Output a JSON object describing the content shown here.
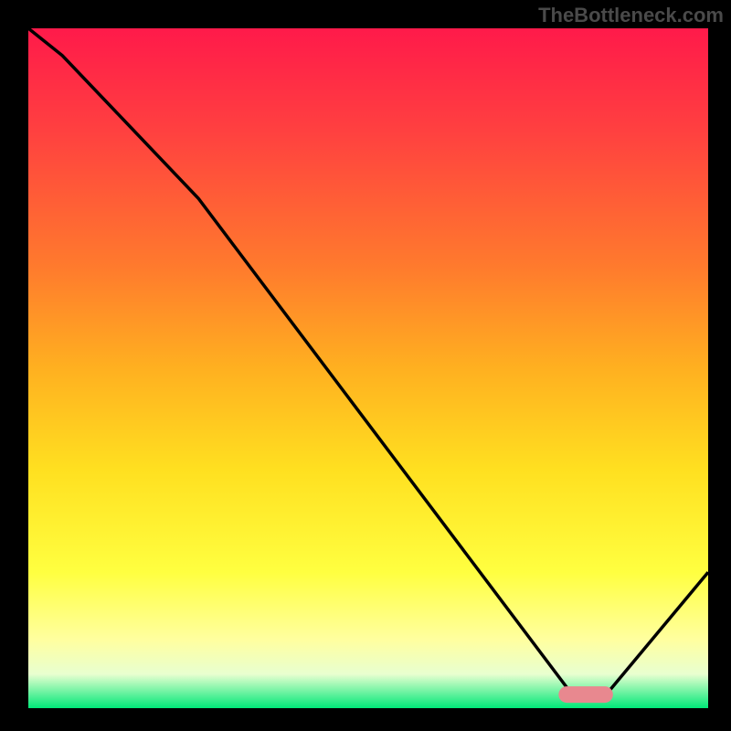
{
  "watermark": "TheBottleneck.com",
  "chart_data": {
    "type": "line",
    "title": "",
    "xlabel": "",
    "ylabel": "",
    "xlim": [
      0,
      100
    ],
    "ylim": [
      0,
      100
    ],
    "series": [
      {
        "name": "curve",
        "x": [
          0,
          5,
          25,
          80,
          85,
          100
        ],
        "y": [
          100,
          96,
          75,
          2,
          2,
          20
        ]
      }
    ],
    "marker": {
      "x_start": 78,
      "x_end": 86,
      "y": 2,
      "color": "#e8888f"
    },
    "gradient_stops": [
      {
        "offset": 0,
        "color": "#ff1a4a"
      },
      {
        "offset": 15,
        "color": "#ff4040"
      },
      {
        "offset": 35,
        "color": "#ff7a2d"
      },
      {
        "offset": 50,
        "color": "#ffb020"
      },
      {
        "offset": 65,
        "color": "#ffe020"
      },
      {
        "offset": 80,
        "color": "#ffff40"
      },
      {
        "offset": 90,
        "color": "#ffffa0"
      },
      {
        "offset": 95,
        "color": "#e8ffd0"
      },
      {
        "offset": 100,
        "color": "#00e878"
      }
    ]
  }
}
